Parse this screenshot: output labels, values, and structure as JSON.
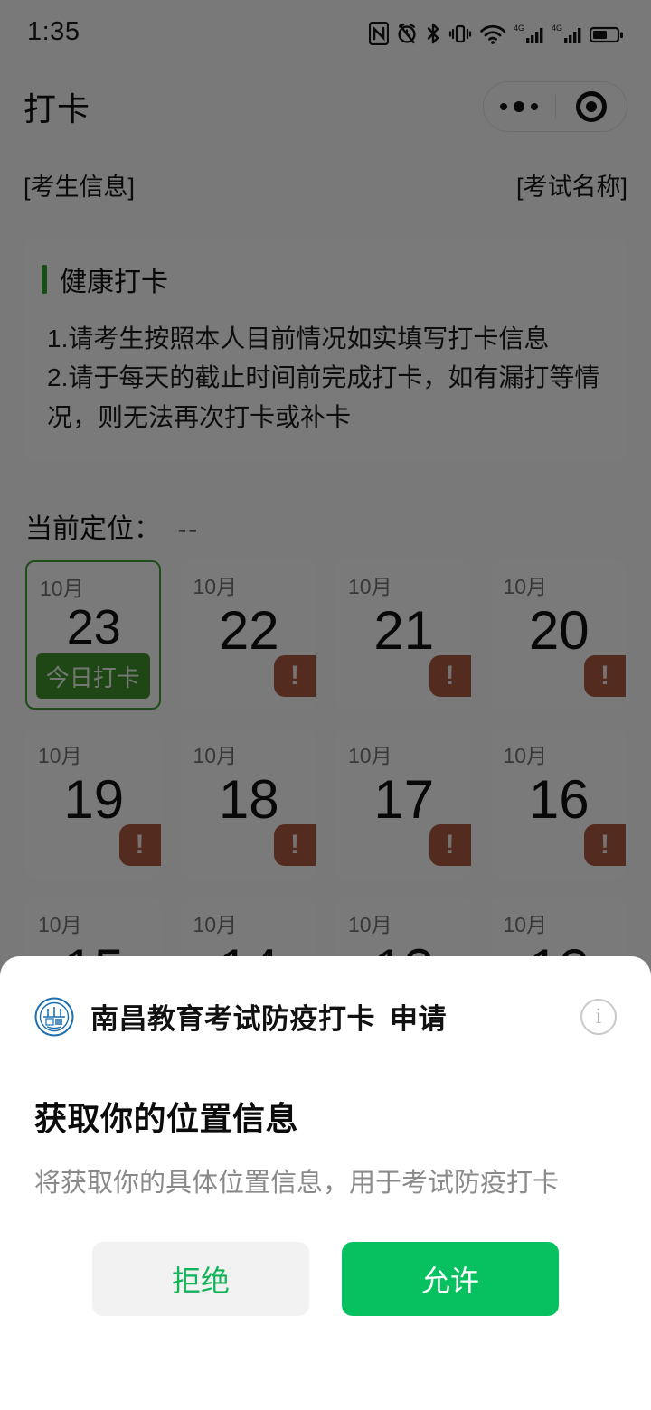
{
  "statusbar": {
    "time": "1:35",
    "icons": [
      "nfc-icon",
      "alarm-off-icon",
      "bluetooth-icon",
      "vibrate-icon",
      "wifi-icon",
      "signal-4g-icon",
      "signal-4g-icon-2",
      "battery-icon"
    ]
  },
  "navbar": {
    "title": "打卡",
    "more_label": "•••",
    "close_label": "◉"
  },
  "exam": {
    "student_info": "[考生信息]",
    "exam_name": "[考试名称]"
  },
  "notice": {
    "title": "健康打卡",
    "items": [
      "1.请考生按照本人目前情况如实填写打卡信息",
      "2.请于每天的截止时间前完成打卡，如有漏打等情况，则无法再次打卡或补卡"
    ]
  },
  "location": {
    "label": "当前定位：",
    "value": "--"
  },
  "calendar": {
    "today_button_label": "今日打卡",
    "badge_label": "!",
    "cards": [
      {
        "month": "10月",
        "day": "23",
        "today": true,
        "badge": false
      },
      {
        "month": "10月",
        "day": "22",
        "today": false,
        "badge": true
      },
      {
        "month": "10月",
        "day": "21",
        "today": false,
        "badge": true
      },
      {
        "month": "10月",
        "day": "20",
        "today": false,
        "badge": true
      },
      {
        "month": "10月",
        "day": "19",
        "today": false,
        "badge": true
      },
      {
        "month": "10月",
        "day": "18",
        "today": false,
        "badge": true
      },
      {
        "month": "10月",
        "day": "17",
        "today": false,
        "badge": true
      },
      {
        "month": "10月",
        "day": "16",
        "today": false,
        "badge": true
      },
      {
        "month": "10月",
        "day": "15",
        "today": false,
        "badge": false
      },
      {
        "month": "10月",
        "day": "14",
        "today": false,
        "badge": false
      },
      {
        "month": "10月",
        "day": "13",
        "today": false,
        "badge": false
      },
      {
        "month": "10月",
        "day": "12",
        "today": false,
        "badge": false
      }
    ]
  },
  "permission_sheet": {
    "app_name": "南昌教育考试防疫打卡",
    "request_word": "申请",
    "info_label": "i",
    "title": "获取你的位置信息",
    "description": "将获取你的具体位置信息，用于考试防疫打卡",
    "reject_label": "拒绝",
    "allow_label": "允许"
  },
  "colors": {
    "brand_green": "#07c160",
    "accent_green": "#2f9b2f",
    "today_border": "#3c9b35",
    "today_button": "#3f8f2d",
    "badge_brown": "#a9573f",
    "reject_text": "#14b359",
    "logo_blue": "#1d6fb0"
  }
}
